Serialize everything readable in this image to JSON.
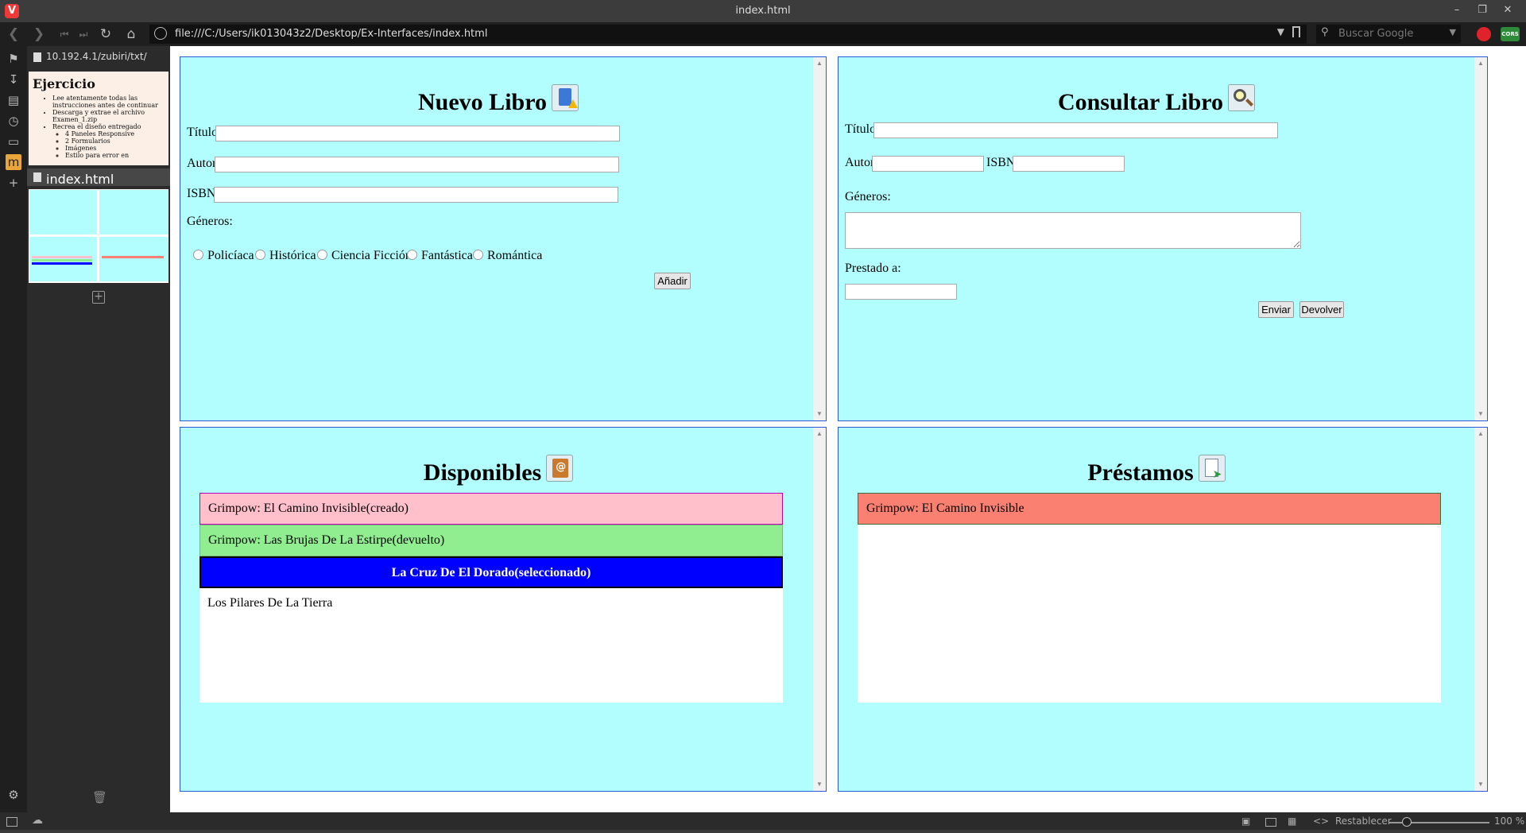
{
  "window": {
    "title": "index.html",
    "logo": "V"
  },
  "nav": {
    "url": "file:///C:/Users/ik013043z2/Desktop/Ex-Interfaces/index.html",
    "search_placeholder": "Buscar Google",
    "ext_green_label": "CORS"
  },
  "sidepanel": {
    "header_url": "10.192.4.1/zubiri/txt/",
    "thumb_title": "Ejercicio",
    "thumb_items": [
      "Lee atentamente todas las instrucciones antes de continuar",
      "Descarga y extrae el archivo Examen_1.zip",
      "Recrea el diseño entregado"
    ],
    "thumb_subitems": [
      "4 Paneles Responsive",
      "2 Formularios",
      "Imágenes",
      "Estilo para error en"
    ],
    "tab_label": "index.html"
  },
  "nuevo": {
    "title": "Nuevo Libro",
    "titulo_label": "Título",
    "autor_label": "Autor",
    "isbn_label": "ISBN",
    "generos_label": "Géneros:",
    "genres": [
      "Policíaca",
      "Histórica",
      "Ciencia Ficción",
      "Fantástica",
      "Romántica"
    ],
    "add_button": "Añadir"
  },
  "consultar": {
    "title": "Consultar Libro",
    "titulo_label": "Título",
    "autor_label": "Autor",
    "isbn_label": "ISBN",
    "generos_label": "Géneros:",
    "prestado_label": "Prestado a:",
    "send_button": "Enviar",
    "return_button": "Devolver"
  },
  "disponibles": {
    "title": "Disponibles",
    "items": [
      "Grimpow: El Camino Invisible(creado)",
      "Grimpow: Las Brujas De La Estirpe(devuelto)",
      "La Cruz De El Dorado(seleccionado)",
      "Los Pilares De La Tierra"
    ],
    "item_colors": [
      "#ffc0cb",
      "#90ee90",
      "#0000ff",
      "#ffffff"
    ]
  },
  "prestamos": {
    "title": "Préstamos",
    "items": [
      "Grimpow: El Camino Invisible"
    ],
    "item_colors": [
      "#fa8072"
    ]
  },
  "statusbar": {
    "reset_label": "Restablecer",
    "zoom": "100 %"
  },
  "colors": {
    "panel_bg": "#b2fefe",
    "panel_border": "#2a5ad9",
    "accent_orange": "#e8a63a"
  }
}
